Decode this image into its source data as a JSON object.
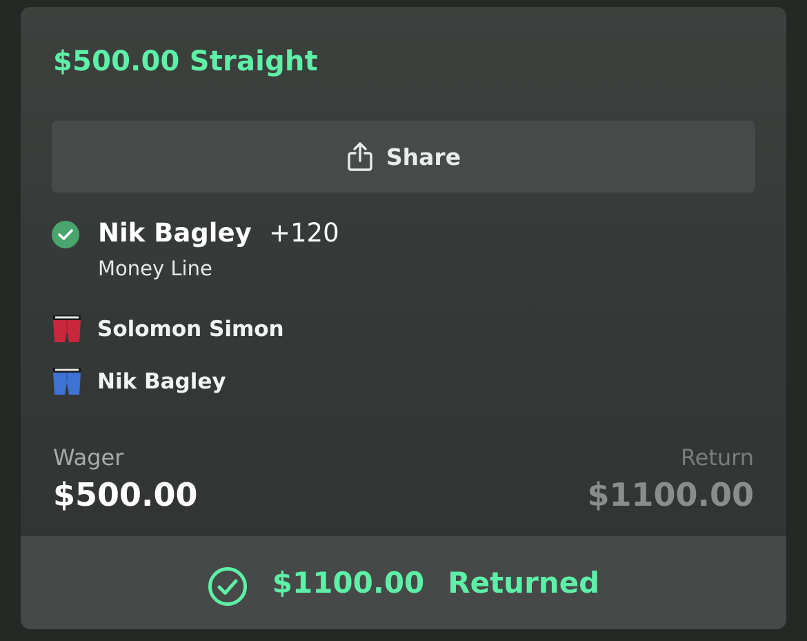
{
  "bet": {
    "title": "$500.00 Straight"
  },
  "share": {
    "label": "Share",
    "icon": "share-icon"
  },
  "selection": {
    "name": "Nik Bagley",
    "odds": "+120",
    "type": "Money Line",
    "status_icon": "check-circle-icon",
    "status_color": "#4aa46d"
  },
  "fighters": [
    {
      "name": "Solomon Simon",
      "icon": "red-trunks-icon",
      "color": "#c8283c"
    },
    {
      "name": "Nik Bagley",
      "icon": "blue-trunks-icon",
      "color": "#3e72d4"
    }
  ],
  "wager": {
    "label": "Wager",
    "value": "$500.00"
  },
  "return": {
    "label": "Return",
    "value": "$1100.00"
  },
  "result": {
    "amount": "$1100.00",
    "status": "Returned",
    "icon": "check-circle-outline-icon",
    "color": "#5ef0a8"
  }
}
